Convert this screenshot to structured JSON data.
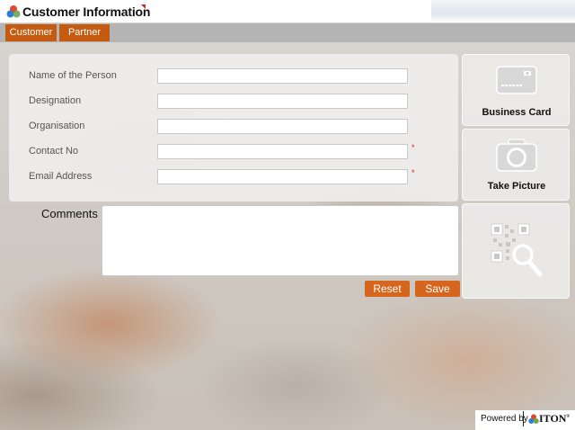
{
  "header": {
    "title": "Customer Information"
  },
  "tabs": [
    {
      "label": "Customer"
    },
    {
      "label": "Partner"
    }
  ],
  "form": {
    "fields": [
      {
        "label": "Name of the Person",
        "value": "",
        "required": false
      },
      {
        "label": "Designation",
        "value": "",
        "required": false
      },
      {
        "label": "Organisation",
        "value": "",
        "required": false
      },
      {
        "label": "Contact No",
        "value": "",
        "required": true
      },
      {
        "label": "Email Address",
        "value": "",
        "required": true
      }
    ],
    "required_mark": "*",
    "comments_label": "Comments",
    "comments_value": ""
  },
  "actions": {
    "reset_label": "Reset",
    "save_label": "Save"
  },
  "side": {
    "business_card_label": "Business Card",
    "take_picture_label": "Take Picture",
    "qr_icon": "qr-scan-icon"
  },
  "footer": {
    "powered_by": "Powered by",
    "brand": "ITON"
  },
  "colors": {
    "accent": "#d6651e",
    "tab_bg": "#c55a11",
    "tabbar": "#b4b4b4",
    "required": "#d0261d"
  }
}
